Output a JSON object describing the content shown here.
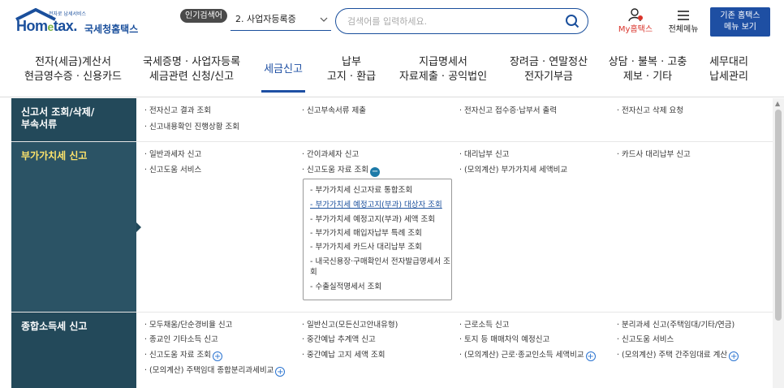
{
  "header": {
    "logo_sub": "전자로 납세서비스",
    "logo_main_a": "Hom",
    "logo_main_e": "e",
    "logo_main_b": "tax.",
    "logo_kr": "국세청홈택스",
    "popular_badge": "인기검색어",
    "popular_selected": "2.  사업자등록증",
    "search_placeholder": "검색어를 입력하세요.",
    "my_hometax": "My홈택스",
    "menu_all": "전체메뉴",
    "old_btn_line1": "기존 홈택스",
    "old_btn_line2": "메뉴 보기"
  },
  "nav": {
    "items": [
      {
        "line1": "전자(세금)계산서",
        "line2": "현금영수증 · 신용카드"
      },
      {
        "line1": "국세증명 · 사업자등록",
        "line2": "세금관련 신청/신고"
      },
      {
        "line1": "세금신고",
        "line2": ""
      },
      {
        "line1": "납부",
        "line2": "고지 · 환급"
      },
      {
        "line1": "지급명세서",
        "line2": "자료제출 · 공익법인"
      },
      {
        "line1": "장려금 · 연말정산",
        "line2": "전자기부금"
      },
      {
        "line1": "상담 · 불복 · 고충",
        "line2": "제보 · 기타"
      },
      {
        "line1": "세무대리",
        "line2": "납세관리"
      }
    ]
  },
  "sections": [
    {
      "title_line1": "신고서 조회/삭제/",
      "title_line2": "부속서류",
      "links": [
        "전자신고 결과 조회",
        "신고부속서류 제출",
        "전자신고 접수증·납부서 출력",
        "전자신고 삭제 요청",
        "신고내용확인 진행상황 조회"
      ]
    },
    {
      "title_line1": "부가가치세 신고",
      "title_line2": "",
      "links": [
        "일반과세자 신고",
        "간이과세자 신고",
        "대리납부 신고",
        "카드사 대리납부 신고",
        "신고도움 서비스",
        "신고도움 자료 조회",
        "(모의계산) 부가가치세 세액비교"
      ],
      "submenu": [
        "- 부가가치세 신고자료 통합조회",
        "- 부가가치세 예정고지(부과) 대상자 조회",
        "- 부가가치세 예정고지(부과) 세액 조회",
        "- 부가가치세 매입자납부 특례 조회",
        "- 부가가치세 카드사 대리납부 조회",
        "- 내국신용장·구매확인서 전자발급명세서 조",
        "   회",
        "- 수출실적명세서 조회"
      ]
    },
    {
      "title_line1": "종합소득세 신고",
      "title_line2": "",
      "links": [
        "모두채움/단순경비율 신고",
        "일반신고(모든신고안내유형)",
        "근로소득 신고",
        "분리과세 신고(주택임대/기타/연금)",
        "종교인 기타소득 신고",
        "중간예납 추계액 신고",
        "토지 등 매매차익 예정신고",
        "신고도움 서비스",
        "신고도움 자료 조회",
        "중간예납 고지 세액 조회",
        "(모의계산) 근로·종교인소득 세액비교",
        "(모의계산) 주택 간주임대료 계산",
        "(모의계산) 주택임대 종합분리과세비교"
      ]
    }
  ],
  "colors": {
    "brand": "#1e4fa3",
    "section_bg": "#23495a",
    "active_title": "#ffe46b",
    "my_red": "#d9342b"
  }
}
